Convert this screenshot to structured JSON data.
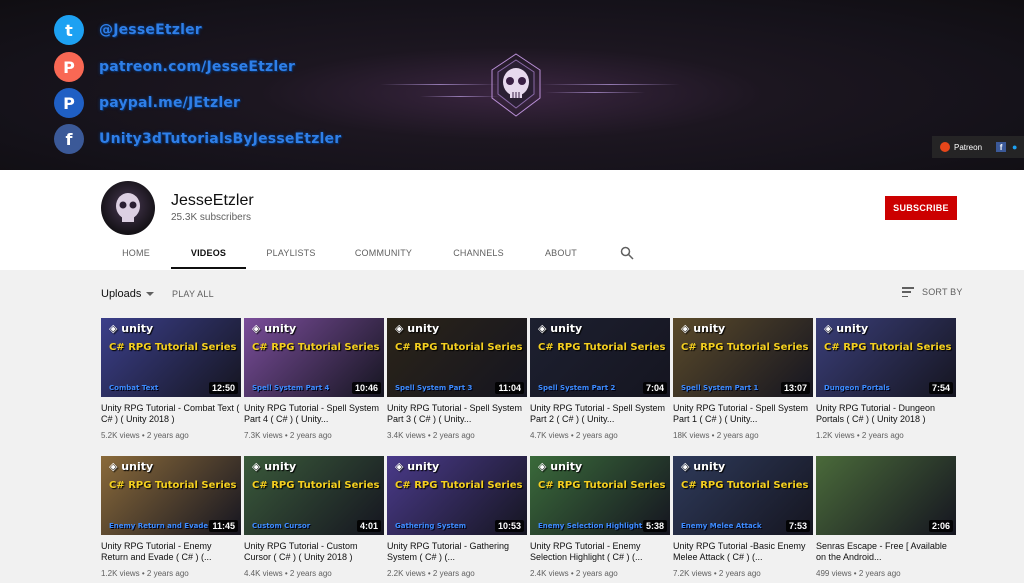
{
  "banner": {
    "socials": [
      {
        "icon": "twitter-icon",
        "glyph": "t",
        "color": "#1da1f2",
        "text": "@JesseEtzler"
      },
      {
        "icon": "patreon-icon",
        "glyph": "P",
        "color": "#f96854",
        "text": "patreon.com/JesseEtzler"
      },
      {
        "icon": "paypal-icon",
        "glyph": "P",
        "color": "#1f5fc4",
        "text": "paypal.me/JEtzler"
      },
      {
        "icon": "facebook-icon",
        "glyph": "f",
        "color": "#3b5998",
        "text": "Unity3dTutorialsByJesseEtzler"
      }
    ],
    "links_label": "Patreon"
  },
  "channel": {
    "name": "JesseEtzler",
    "subscribers": "25.3K subscribers",
    "subscribe_label": "SUBSCRIBE"
  },
  "tabs": [
    {
      "label": "HOME",
      "active": false
    },
    {
      "label": "VIDEOS",
      "active": true
    },
    {
      "label": "PLAYLISTS",
      "active": false
    },
    {
      "label": "COMMUNITY",
      "active": false
    },
    {
      "label": "CHANNELS",
      "active": false
    },
    {
      "label": "ABOUT",
      "active": false
    }
  ],
  "toolbar": {
    "uploads_label": "Uploads",
    "play_all_label": "PLAY ALL",
    "sort_label": "SORT BY"
  },
  "videos": [
    {
      "title": "Unity RPG Tutorial - Combat Text ( C# ) ( Unity 2018 )",
      "meta": "5.2K views • 2 years ago",
      "duration": "12:50",
      "thumb_title": "C# RPG Tutorial Series",
      "thumb_sub": "Combat Text",
      "bg": "#3b3f8a"
    },
    {
      "title": "Unity RPG Tutorial - Spell System Part 4 ( C# ) ( Unity...",
      "meta": "7.3K views • 2 years ago",
      "duration": "10:46",
      "thumb_title": "C# RPG Tutorial Series",
      "thumb_sub": "Spell System Part 4",
      "bg": "#7a4d9a"
    },
    {
      "title": "Unity RPG Tutorial - Spell System Part 3 ( C# ) ( Unity...",
      "meta": "3.4K views • 2 years ago",
      "duration": "11:04",
      "thumb_title": "C# RPG Tutorial Series",
      "thumb_sub": "Spell System Part 3",
      "bg": "#2b2418"
    },
    {
      "title": "Unity RPG Tutorial - Spell System Part 2 ( C# ) ( Unity...",
      "meta": "4.7K views • 2 years ago",
      "duration": "7:04",
      "thumb_title": "C# RPG Tutorial Series",
      "thumb_sub": "Spell System Part 2",
      "bg": "#1d2030"
    },
    {
      "title": "Unity RPG Tutorial - Spell System Part 1 ( C# ) ( Unity...",
      "meta": "18K views • 2 years ago",
      "duration": "13:07",
      "thumb_title": "C# RPG Tutorial Series",
      "thumb_sub": "Spell System Part 1",
      "bg": "#5a4a2a"
    },
    {
      "title": "Unity RPG Tutorial - Dungeon Portals ( C# ) ( Unity 2018 )",
      "meta": "1.2K views • 2 years ago",
      "duration": "7:54",
      "thumb_title": "C# RPG Tutorial Series",
      "thumb_sub": "Dungeon Portals",
      "bg": "#3a3e78"
    },
    {
      "title": "Unity RPG Tutorial - Enemy Return and Evade ( C# ) (...",
      "meta": "1.2K views • 2 years ago",
      "duration": "11:45",
      "thumb_title": "C# RPG Tutorial Series",
      "thumb_sub": "Enemy Return and Evade",
      "bg": "#8a6a3a"
    },
    {
      "title": "Unity RPG Tutorial - Custom Cursor ( C# ) ( Unity 2018 )",
      "meta": "4.4K views • 2 years ago",
      "duration": "4:01",
      "thumb_title": "C# RPG Tutorial Series",
      "thumb_sub": "Custom Cursor",
      "bg": "#3a5a3a"
    },
    {
      "title": "Unity RPG Tutorial - Gathering System ( C# ) (...",
      "meta": "2.2K views • 2 years ago",
      "duration": "10:53",
      "thumb_title": "C# RPG Tutorial Series",
      "thumb_sub": "Gathering System",
      "bg": "#4a3a8a"
    },
    {
      "title": "Unity RPG Tutorial - Enemy Selection Highlight ( C# ) (...",
      "meta": "2.4K views • 2 years ago",
      "duration": "5:38",
      "thumb_title": "C# RPG Tutorial Series",
      "thumb_sub": "Enemy Selection Highlight",
      "bg": "#3a6a3a"
    },
    {
      "title": "Unity RPG Tutorial -Basic Enemy Melee Attack ( C# ) (...",
      "meta": "7.2K views • 2 years ago",
      "duration": "7:53",
      "thumb_title": "C# RPG Tutorial Series",
      "thumb_sub": "Enemy Melee Attack",
      "bg": "#2e3a5a"
    },
    {
      "title": "Senras Escape - Free [ Available on the Android...",
      "meta": "499 views • 2 years ago",
      "duration": "2:06",
      "thumb_title": "",
      "thumb_sub": "",
      "bg": "#4a6a3a"
    }
  ],
  "colors": {
    "accent": "#cc0000",
    "banner_text": "#2f7fe8",
    "thumb_title": "#f5d020"
  }
}
